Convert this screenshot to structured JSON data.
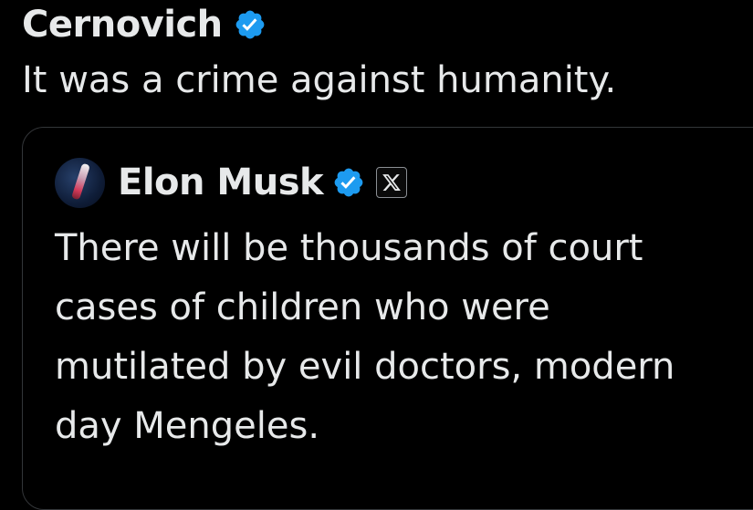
{
  "post": {
    "author_name": "Cernovich",
    "text": "It was a crime against humanity."
  },
  "quoted_post": {
    "author_name": "Elon Musk",
    "text_lines": [
      "There will be thousands of court",
      "cases of children who were",
      "mutilated by evil doctors, modern",
      "day Mengeles."
    ]
  },
  "icons": {
    "verified": "verified-badge-icon",
    "affiliate": "x-logo-icon",
    "avatar": "rocket-avatar"
  },
  "colors": {
    "background": "#000000",
    "text": "#e7e9ea",
    "verified_blue": "#1d9bf0",
    "card_border": "#333639"
  }
}
